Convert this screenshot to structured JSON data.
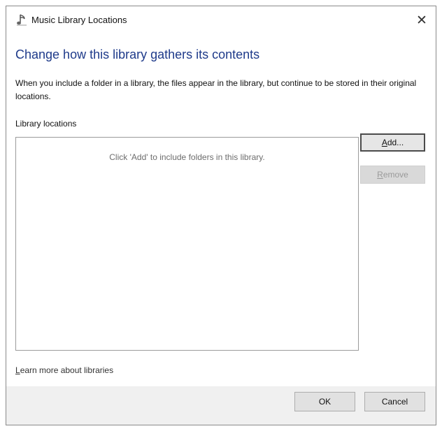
{
  "window": {
    "title": "Music Library Locations",
    "close_glyph": "✕",
    "icon": "music-note-icon"
  },
  "main": {
    "heading": "Change how this library gathers its contents",
    "description": "When you include a folder in a library, the files appear in the library, but continue to be stored in their original locations.",
    "locations_label": "Library locations",
    "empty_message": "Click 'Add' to include folders in this library."
  },
  "buttons": {
    "add_label": "Add...",
    "remove_label": "Remove",
    "ok_label": "OK",
    "cancel_label": "Cancel"
  },
  "links": {
    "learn_more": "Learn more about libraries"
  },
  "colors": {
    "heading": "#1e3a8a",
    "footer_bg": "#f0f0f0",
    "button_bg": "#e1e1e1"
  }
}
